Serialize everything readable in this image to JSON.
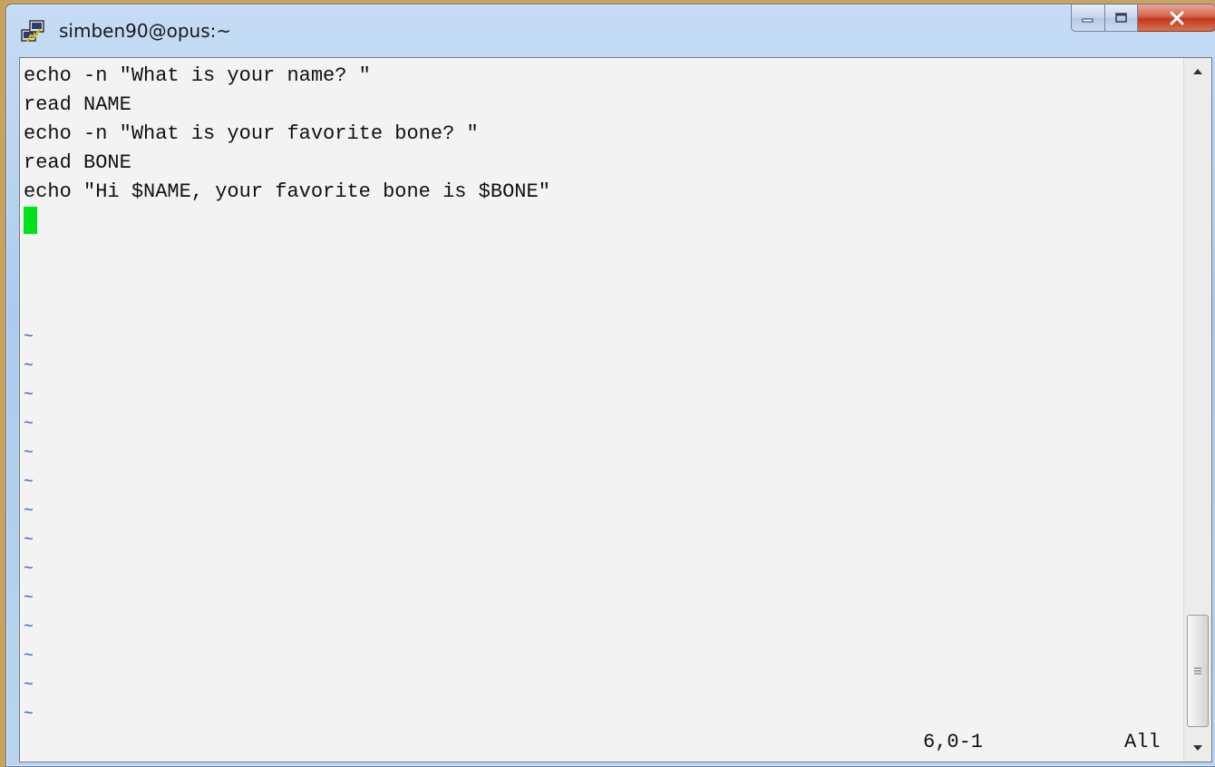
{
  "window": {
    "title": "simben90@opus:~",
    "icon": "putty-icon",
    "controls": [
      "minimize-icon",
      "maximize-icon",
      "close-icon"
    ]
  },
  "editor": {
    "lines": [
      "echo -n \"What is your name? \"",
      "read NAME",
      "echo -n \"What is your favorite bone? \"",
      "read BONE",
      "echo \"Hi $NAME, your favorite bone is $BONE\""
    ],
    "empty_line_marker": "~",
    "cursor_color": "#00e21a",
    "tilde_color": "#2b53e0"
  },
  "status": {
    "position": "6,0-1",
    "scroll": "All"
  },
  "scrollbar": {
    "icons": [
      "scroll-up-arrow-icon",
      "scroll-down-arrow-icon",
      "grip-icon"
    ]
  }
}
